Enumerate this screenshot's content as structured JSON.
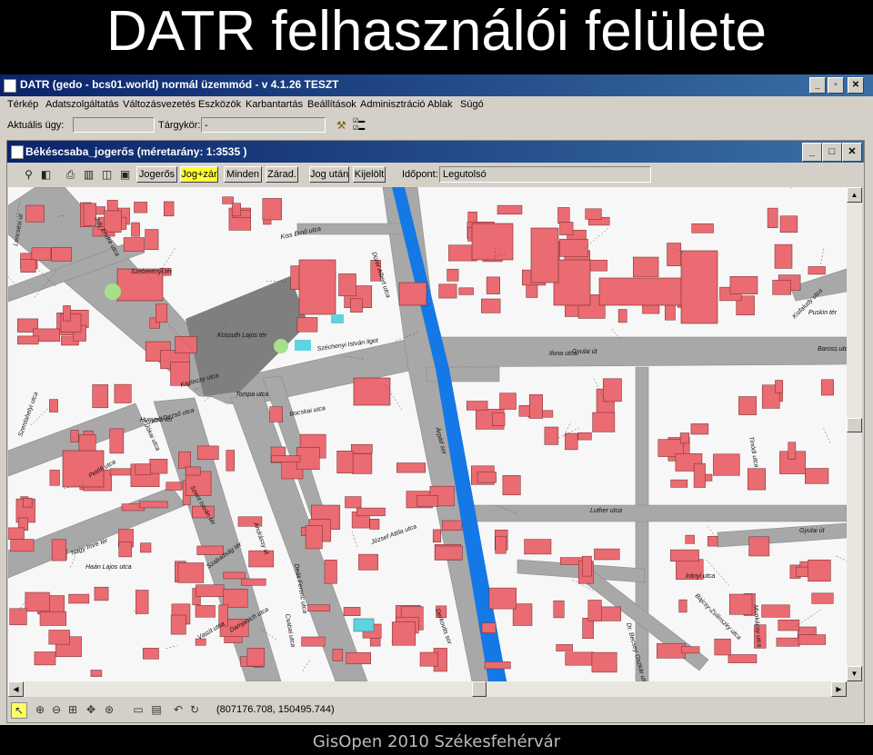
{
  "slide": {
    "title": "DATR felhasználói felülete",
    "footer": "GisOpen 2010 Székesfehérvár"
  },
  "app": {
    "title": "DATR (gedo - bcs01.world) normál üzemmód - v 4.1.26 TESZT",
    "menu": [
      "Térkép",
      "Adatszolgáltatás",
      "Változásvezetés",
      "Eszközök",
      "Karbantartás",
      "Beállítások",
      "Adminisztráció",
      "Ablak",
      "Súgó"
    ],
    "current_case_label": "Aktuális ügy:",
    "current_case_value": "",
    "subject_label": "Tárgykör:",
    "subject_value": "-"
  },
  "map_window": {
    "title": "Békéscsaba_jogerős  (méretarány: 1:3535 )",
    "buttons": [
      "Jogerős",
      "Jog+zár",
      "Minden",
      "Zárad.",
      "Jog után",
      "Kijelölt"
    ],
    "active_button": "Jog+zár",
    "timepoint_label": "Időpont:",
    "timepoint_value": "Legutolsó",
    "coordinates": "(807176.708, 150495.744)",
    "street_labels": [
      "Szeberényi tér",
      "Kossuth Lajos tér",
      "Kiss Ernő utca",
      "Dürer Albert utca",
      "Szabó Dezső utca",
      "Gyulai út",
      "Széchenyi István liget",
      "Bocskai utca",
      "Baross utca",
      "Kisfaludy utca",
      "Jókai utca",
      "Szent István tér",
      "Andrássy út",
      "Szabadság tér",
      "Deák Ferenc utca",
      "Luther utca",
      "Irányi utca",
      "Nagy Imre tér",
      "Haán Lajos utca",
      "Petőfi utca",
      "József Attila utca",
      "Árpád sor",
      "Derkovits sor",
      "Dr. Becsey Oszkár utca",
      "Munkácsy utca",
      "Puskin tér",
      "Ady Endre utca",
      "Gyulai út",
      "Bajcsy-Zsilinszky utca",
      "Tinódi utca",
      "Lencsési út",
      "Kazinczy utca",
      "Szerdahelyi utca",
      "Vasút utca",
      "Csabai utca",
      "Hunyadi tér",
      "Damjanich utca",
      "Tompa utca",
      "Ilona utca"
    ]
  },
  "colors": {
    "building": "#ea6b71",
    "road": "#a8a8a8",
    "square": "#7f7f7f",
    "canal": "#1478e6",
    "titlebar": "#0a246a",
    "active_button": "#ffff33"
  }
}
